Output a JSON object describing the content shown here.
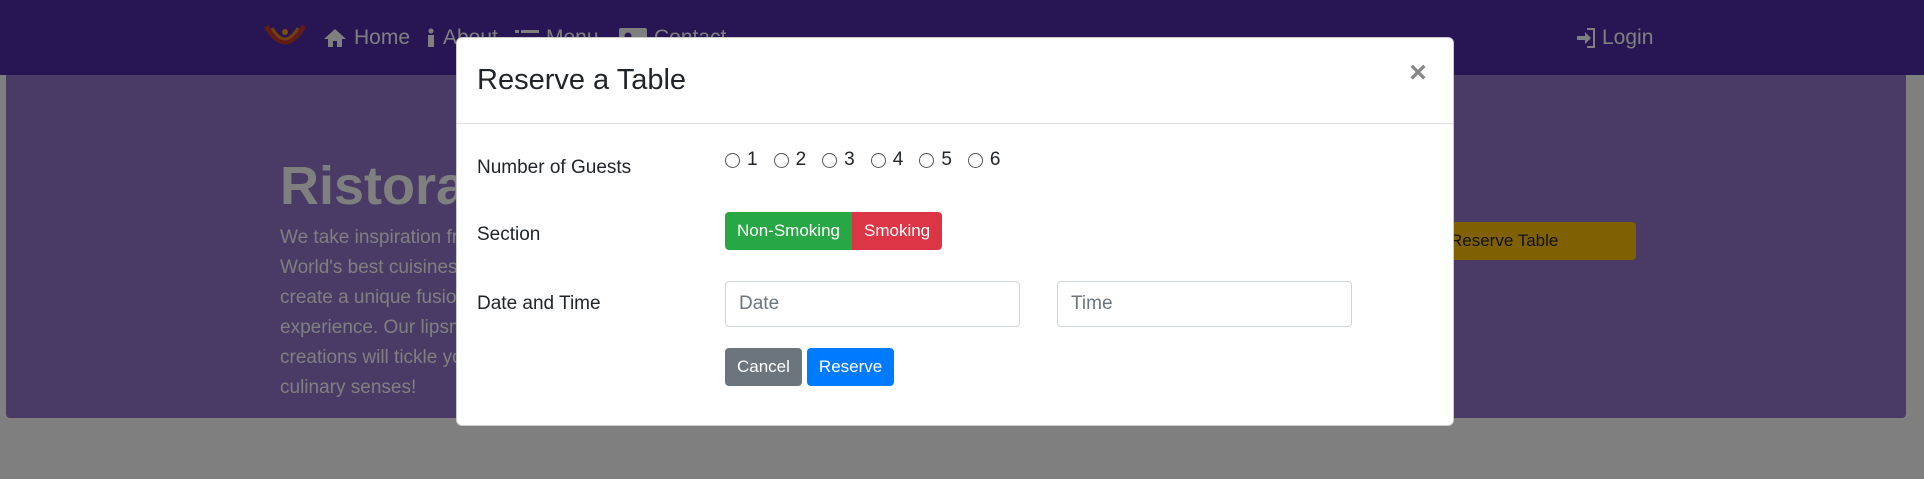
{
  "navbar": {
    "items": [
      {
        "label": "Home",
        "icon": "home-icon"
      },
      {
        "label": "About",
        "icon": "info-icon"
      },
      {
        "label": "Menu",
        "icon": "list-icon"
      },
      {
        "label": "Contact",
        "icon": "address-card-icon"
      }
    ],
    "login_label": "Login"
  },
  "jumbotron": {
    "title": "Ristorante con Fusion",
    "text": "We take inspiration from World's best cuisines, and create a unique fusion experience. Our lipsmacking creations will tickle your culinary senses!",
    "reserve_label": "Reserve Table"
  },
  "modal": {
    "title": "Reserve a Table",
    "close_label": "×",
    "guests_label": "Number of Guests",
    "guest_options": [
      "1",
      "2",
      "3",
      "4",
      "5",
      "6"
    ],
    "section_label": "Section",
    "non_smoking_label": "Non-Smoking",
    "smoking_label": "Smoking",
    "datetime_label": "Date and Time",
    "date_placeholder": "Date",
    "time_placeholder": "Time",
    "cancel_label": "Cancel",
    "reserve_label": "Reserve"
  },
  "colors": {
    "navbar": "#512da8",
    "jumbotron": "#9575cd",
    "success": "#28a745",
    "danger": "#dc3545",
    "primary": "#007bff",
    "secondary": "#6c757d",
    "warning": "#ffc107"
  }
}
